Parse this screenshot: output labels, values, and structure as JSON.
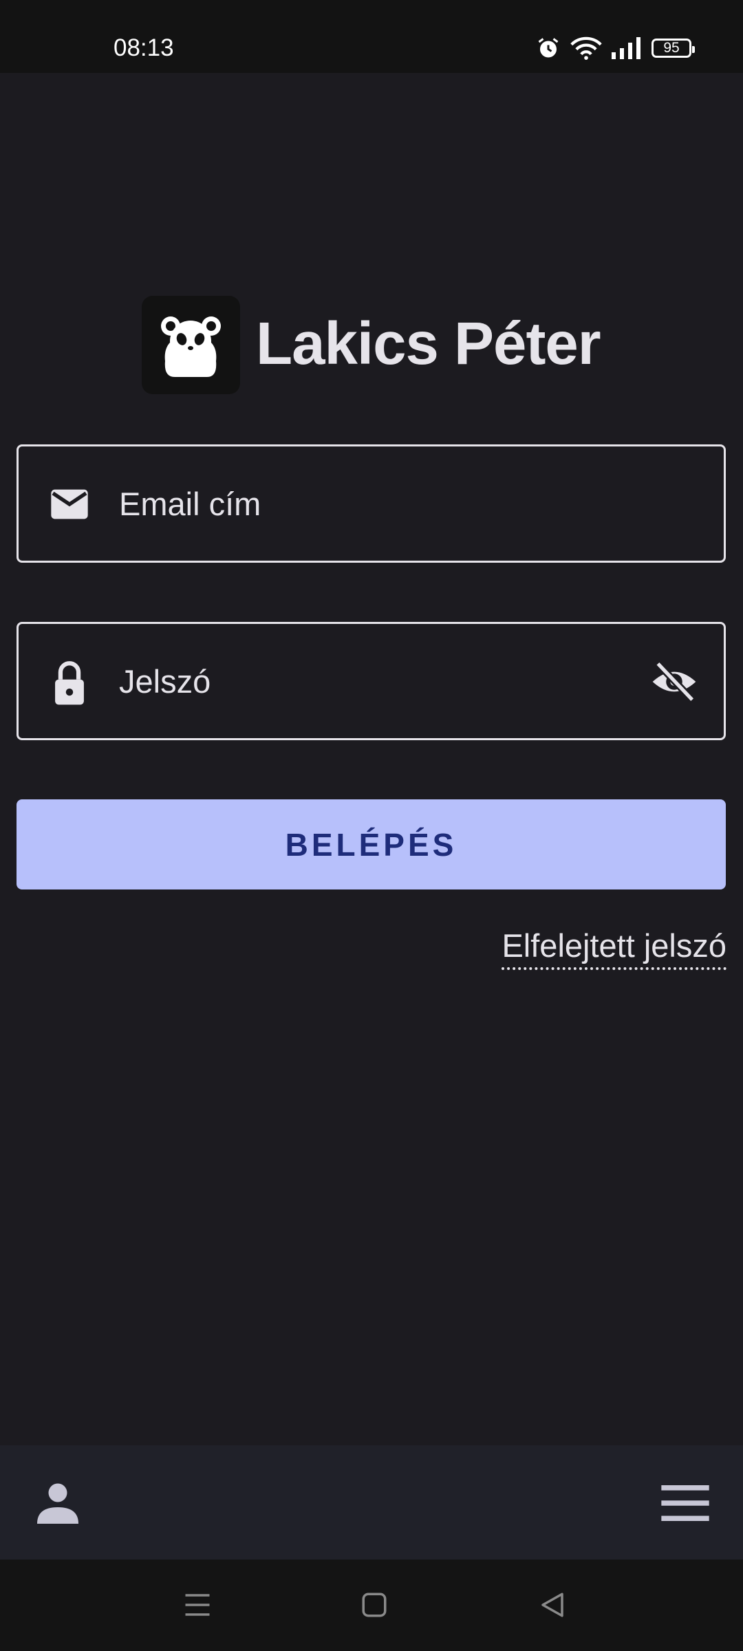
{
  "status_bar": {
    "time": "08:13",
    "battery_level": "95",
    "icons": [
      "alarm-icon",
      "wifi-icon",
      "signal-icon",
      "battery-icon"
    ]
  },
  "header": {
    "logo_icon": "panda-logo-icon",
    "title": "Lakics Péter"
  },
  "login_form": {
    "email": {
      "placeholder": "Email cím",
      "value": "",
      "icon": "email-icon"
    },
    "password": {
      "placeholder": "Jelszó",
      "value": "",
      "icon": "lock-icon",
      "toggle_icon": "visibility-off-icon"
    },
    "submit_label": "BELÉPÉS",
    "forgot_password_label": "Elfelejtett jelszó"
  },
  "bottom_bar": {
    "left_icon": "person-icon",
    "right_icon": "menu-icon"
  },
  "system_nav": [
    "recent-apps-icon",
    "home-icon",
    "back-icon"
  ],
  "colors": {
    "background": "#1c1b20",
    "primary_button": "#b7c0fb",
    "primary_button_text": "#1e2c7a",
    "text": "#e6e4ea",
    "bottom_bar": "#202129"
  }
}
